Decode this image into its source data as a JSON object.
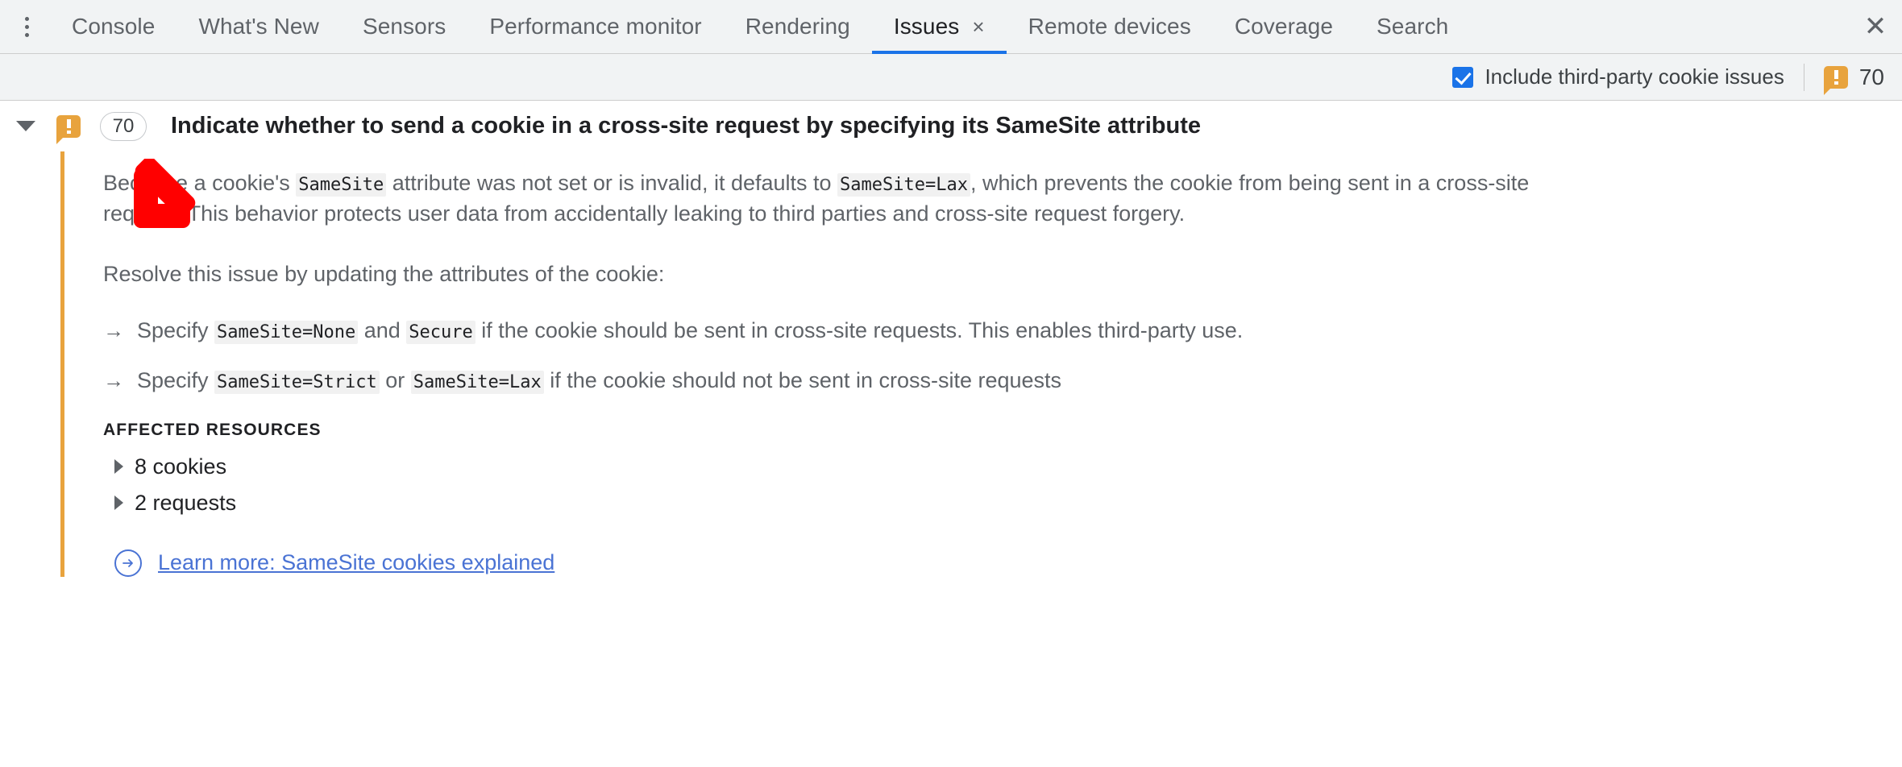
{
  "tabs": [
    {
      "label": "Console",
      "active": false,
      "closable": false
    },
    {
      "label": "What's New",
      "active": false,
      "closable": false
    },
    {
      "label": "Sensors",
      "active": false,
      "closable": false
    },
    {
      "label": "Performance monitor",
      "active": false,
      "closable": false
    },
    {
      "label": "Rendering",
      "active": false,
      "closable": false
    },
    {
      "label": "Issues",
      "active": true,
      "closable": true
    },
    {
      "label": "Remote devices",
      "active": false,
      "closable": false
    },
    {
      "label": "Coverage",
      "active": false,
      "closable": false
    },
    {
      "label": "Search",
      "active": false,
      "closable": false
    }
  ],
  "tabbar": {
    "menu_icon": "more-vertical-icon",
    "close_icon": "close-icon",
    "tab_close_glyph": "×",
    "panel_close_glyph": "✕",
    "active_underline_color": "#1a73e8"
  },
  "toolbar": {
    "include_third_party_label": "Include third-party cookie issues",
    "include_third_party_checked": true,
    "checkbox_color": "#1a73e8",
    "warning_icon": "warning-speech-bubble-icon",
    "warning_color": "#e8a33d",
    "issue_count": "70"
  },
  "issue": {
    "expanded": true,
    "expand_glyph": "▼",
    "warning_icon": "warning-speech-bubble-icon",
    "count_badge": "70",
    "title": "Indicate whether to send a cookie in a cross-site request by specifying its SameSite attribute",
    "accent_color": "#e8a33d",
    "paragraph1": {
      "t1": "Because a cookie's ",
      "c1": "SameSite",
      "t2": " attribute was not set or is invalid, it defaults to ",
      "c2": "SameSite=Lax",
      "t3": ", which prevents the cookie from being sent in a cross-site request. This behavior protects user data from accidentally leaking to third parties and cross-site request forgery."
    },
    "paragraph2": "Resolve this issue by updating the attributes of the cookie:",
    "bullet_marker": "→",
    "bullets": [
      {
        "t1": "Specify ",
        "c1": "SameSite=None",
        "t2": " and ",
        "c2": "Secure",
        "t3": " if the cookie should be sent in cross-site requests. This enables third-party use."
      },
      {
        "t1": "Specify ",
        "c1": "SameSite=Strict",
        "t2": " or ",
        "c2": "SameSite=Lax",
        "t3": " if the cookie should not be sent in cross-site requests"
      }
    ],
    "affected_resources_label": "AFFECTED RESOURCES",
    "resources": [
      {
        "label": "8 cookies",
        "expanded": false
      },
      {
        "label": "2 requests",
        "expanded": false
      }
    ],
    "learn_more": {
      "icon": "circle-arrow-right-icon",
      "label": "Learn more: SameSite cookies explained",
      "color": "#4a73d4"
    }
  },
  "annotation": {
    "arrow_icon": "down-left-arrow-annotation",
    "color": "#ff0000"
  }
}
